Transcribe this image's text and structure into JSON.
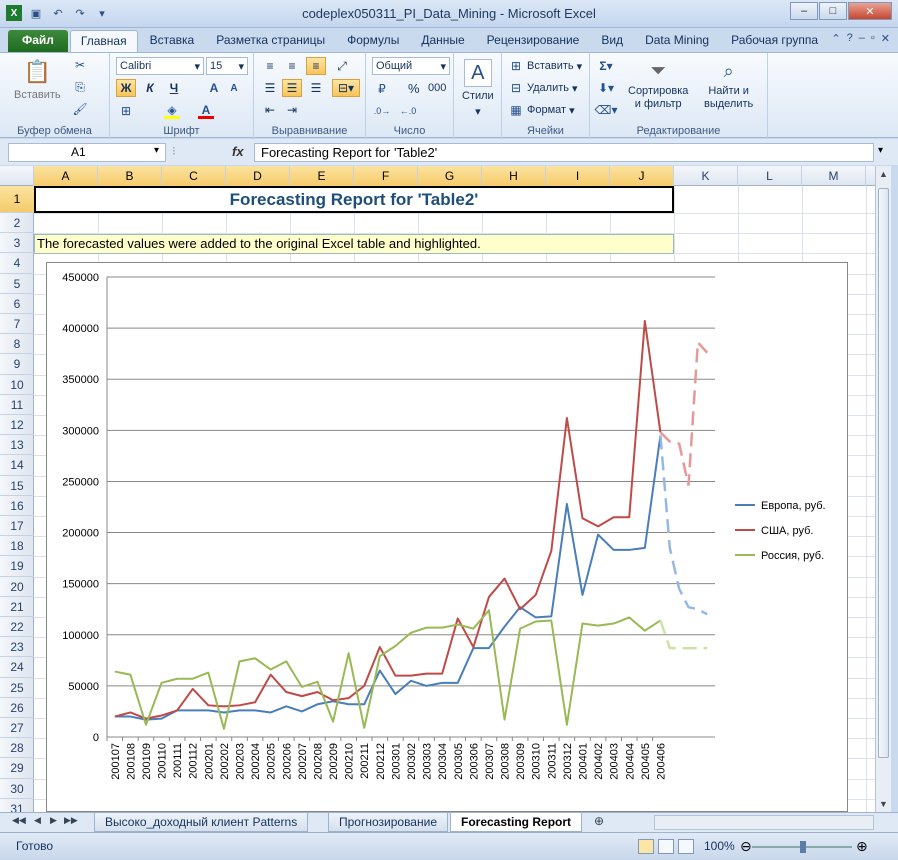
{
  "window": {
    "title": "codeplex050311_PI_Data_Mining  -  Microsoft Excel",
    "qat_icons": [
      "excel-logo-icon",
      "save-icon",
      "undo-icon",
      "redo-icon",
      "customize-qat-icon"
    ]
  },
  "tabs": [
    "Файл",
    "Главная",
    "Вставка",
    "Разметка страницы",
    "Формулы",
    "Данные",
    "Рецензирование",
    "Вид",
    "Data Mining",
    "Рабочая группа"
  ],
  "active_tab": "Главная",
  "ribbon": {
    "clipboard": {
      "paste_label": "Вставить",
      "group_label": "Буфер обмена"
    },
    "font": {
      "font_name": "Calibri",
      "font_size": "15",
      "bold": "Ж",
      "italic": "К",
      "underline": "Ч",
      "group_label": "Шрифт"
    },
    "alignment": {
      "group_label": "Выравнивание"
    },
    "number": {
      "format": "Общий",
      "percent": "%",
      "thousands": "000",
      "group_label": "Число"
    },
    "styles": {
      "label": "Стили"
    },
    "cells": {
      "insert": "Вставить",
      "delete": "Удалить",
      "format": "Формат",
      "group_label": "Ячейки"
    },
    "editing": {
      "sort_label_1": "Сортировка",
      "sort_label_2": "и фильтр",
      "find_label_1": "Найти и",
      "find_label_2": "выделить",
      "group_label": "Редактирование"
    }
  },
  "formula_bar": {
    "name_box": "A1",
    "fx": "fx",
    "formula": "Forecasting Report for 'Table2'"
  },
  "columns": [
    "A",
    "B",
    "C",
    "D",
    "E",
    "F",
    "G",
    "H",
    "I",
    "J",
    "K",
    "L",
    "M"
  ],
  "rows": [
    "1",
    "2",
    "3",
    "4",
    "5",
    "6",
    "7",
    "8",
    "9",
    "10",
    "11",
    "12",
    "13",
    "14",
    "15",
    "16",
    "17",
    "18",
    "19",
    "20",
    "21",
    "22",
    "23",
    "24",
    "25",
    "26",
    "27",
    "28",
    "29",
    "30",
    "31"
  ],
  "cells": {
    "A1": "Forecasting Report for 'Table2'",
    "A3": "The forecasted values were added to the original Excel table and highlighted."
  },
  "chart_data": {
    "type": "line",
    "title": "",
    "xlabel": "",
    "ylabel": "",
    "ylim": [
      0,
      450000
    ],
    "yticks": [
      "0",
      "50000",
      "100000",
      "150000",
      "200000",
      "250000",
      "300000",
      "350000",
      "400000",
      "450000"
    ],
    "legend_position": "right",
    "grid": true,
    "categories": [
      "200107",
      "200108",
      "200109",
      "200110",
      "200111",
      "200112",
      "200201",
      "200202",
      "200203",
      "200204",
      "200205",
      "200206",
      "200207",
      "200208",
      "200209",
      "200210",
      "200211",
      "200212",
      "200301",
      "200302",
      "200303",
      "200304",
      "200305",
      "200306",
      "200307",
      "200308",
      "200309",
      "200310",
      "200311",
      "200312",
      "200401",
      "200402",
      "200403",
      "200404",
      "200405",
      "200406"
    ],
    "forecast_points": 3,
    "series": [
      {
        "name": "Европа, руб.",
        "color": "#4a7ebb",
        "forecast_color": "#95b8e3",
        "values": [
          20000,
          20000,
          17000,
          18000,
          26000,
          26000,
          26000,
          24000,
          26000,
          26000,
          24000,
          30000,
          25000,
          32000,
          35000,
          32000,
          32000,
          65000,
          42000,
          55000,
          50000,
          53000,
          53000,
          87000,
          87000,
          108000,
          127000,
          117000,
          118000,
          228000,
          139000,
          198000,
          183000,
          183000,
          185000,
          295000
        ],
        "forecast": [
          185000,
          145000,
          127000,
          125000,
          120000
        ]
      },
      {
        "name": "США, руб.",
        "color": "#be4b48",
        "forecast_color": "#e39a98",
        "values": [
          20000,
          24000,
          18000,
          21000,
          26000,
          47000,
          31000,
          30000,
          31000,
          34000,
          61000,
          44000,
          40000,
          44000,
          36000,
          38000,
          50000,
          88000,
          60000,
          60000,
          62000,
          62000,
          116000,
          88000,
          137000,
          155000,
          125000,
          139000,
          182000,
          312000,
          214000,
          206000,
          215000,
          215000,
          407000,
          298000
        ],
        "forecast": [
          289000,
          287000,
          246000,
          386000,
          376000
        ]
      },
      {
        "name": "Россия, руб.",
        "color": "#98b954",
        "forecast_color": "#cfe0a6",
        "values": [
          64000,
          61000,
          12000,
          53000,
          57000,
          57000,
          63000,
          8000,
          74000,
          77000,
          66000,
          74000,
          49000,
          54000,
          15000,
          82000,
          9000,
          79000,
          89000,
          102000,
          107000,
          107000,
          110000,
          106000,
          124000,
          17000,
          106000,
          113000,
          114000,
          12000,
          111000,
          109000,
          111000,
          117000,
          104000,
          114000
        ],
        "forecast": [
          87000,
          87000,
          87000,
          87000,
          87000
        ]
      }
    ]
  },
  "sheets": [
    "Высоко_доходный клиент Patterns",
    "Прогнозирование",
    "Forecasting Report"
  ],
  "active_sheet": "Forecasting Report",
  "status": {
    "ready": "Готово",
    "zoom": "100%",
    "zoom_value": 1.0
  }
}
